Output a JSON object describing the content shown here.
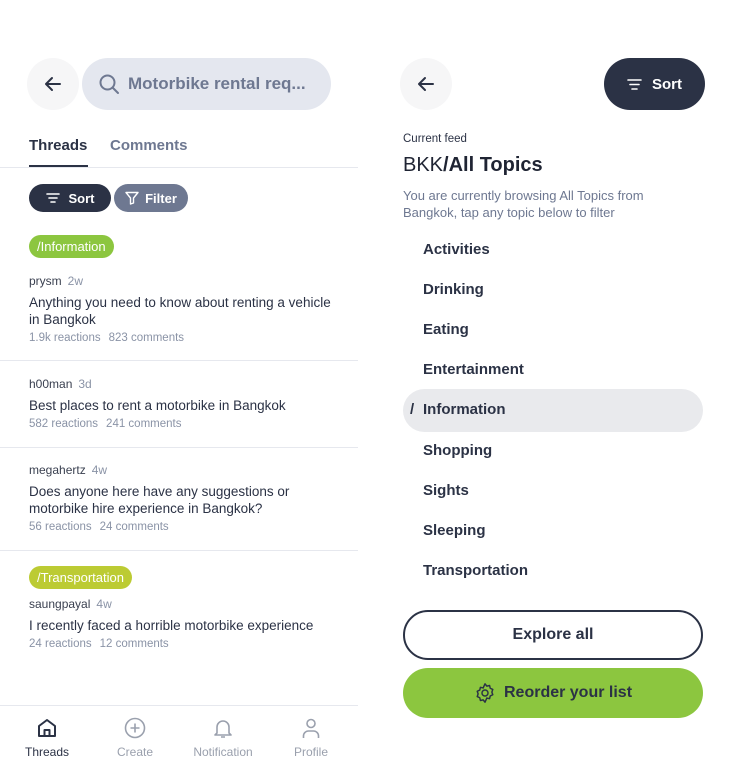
{
  "left": {
    "search_value": "Motorbike rental req...",
    "tabs": [
      {
        "label": "Threads",
        "active": true
      },
      {
        "label": "Comments",
        "active": false
      }
    ],
    "sort_label": "Sort",
    "filter_label": "Filter",
    "posts": [
      {
        "tag": "/Information",
        "tag_color": "#8cc63f",
        "user": "prysm",
        "time": "2w",
        "title": "Anything you need to know about renting a vehicle in Bangkok",
        "reactions": "1.9k reactions",
        "comments": "823 comments"
      },
      {
        "user": "h00man",
        "time": "3d",
        "title": "Best places to rent a motorbike in Bangkok",
        "reactions": "582 reactions",
        "comments": "241 comments"
      },
      {
        "user": "megahertz",
        "time": "4w",
        "title": "Does anyone here have any suggestions or motorbike hire experience in Bangkok?",
        "reactions": "56 reactions",
        "comments": "24 comments"
      },
      {
        "tag": "/Transportation",
        "tag_color": "#bccb33",
        "user": "saungpayal",
        "time": "4w",
        "title": "I recently faced a horrible motorbike experience",
        "reactions": "24 reactions",
        "comments": "12 comments"
      }
    ],
    "nav": [
      {
        "label": "Threads",
        "icon": "home-icon",
        "active": true
      },
      {
        "label": "Create",
        "icon": "plus-circle-icon"
      },
      {
        "label": "Notification",
        "icon": "bell-icon"
      },
      {
        "label": "Profile",
        "icon": "user-icon"
      }
    ]
  },
  "right": {
    "sort_label": "Sort",
    "current_feed_label": "Current feed",
    "feed_city": "BKK",
    "feed_topic": "/All Topics",
    "description": "You are currently browsing All Topics from Bangkok, tap any topic below to filter",
    "topics": [
      "Activities",
      "Drinking",
      "Eating",
      "Entertainment",
      "Information",
      "Shopping",
      "Sights",
      "Sleeping",
      "Transportation"
    ],
    "selected_topic": "Information",
    "selected_marker": "/",
    "explore_label": "Explore all",
    "reorder_label": "Reorder your list"
  },
  "colors": {
    "dark": "#2b3245",
    "green": "#8cc63f",
    "slate": "#6e7891"
  }
}
